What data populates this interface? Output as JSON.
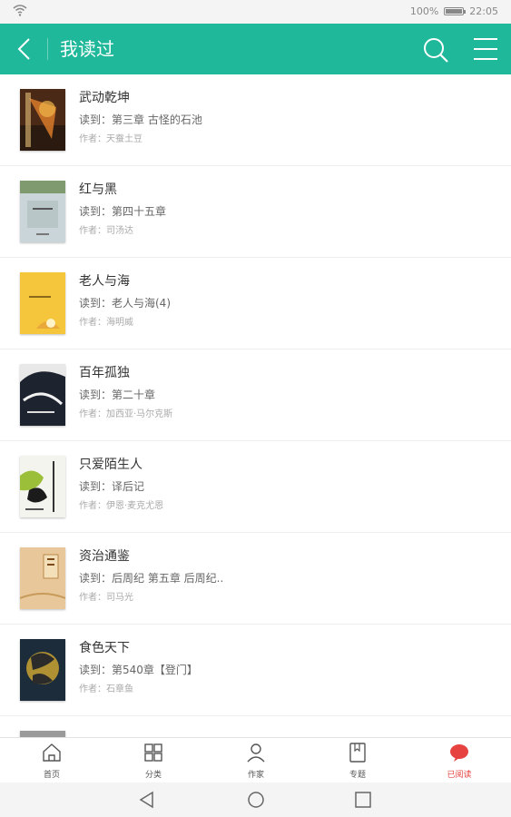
{
  "status": {
    "battery": "100%",
    "time": "22:05",
    "battery_level": 1.0
  },
  "header": {
    "title": "我读过"
  },
  "books": [
    {
      "title": "武动乾坤",
      "read": "读到：第三章 古怪的石池",
      "author": "作者：天蚕土豆"
    },
    {
      "title": "红与黑",
      "read": "读到：第四十五章",
      "author": "作者：司汤达"
    },
    {
      "title": "老人与海",
      "read": "读到：老人与海(4)",
      "author": "作者：海明威"
    },
    {
      "title": "百年孤独",
      "read": "读到：第二十章",
      "author": "作者：加西亚·马尔克斯"
    },
    {
      "title": "只爱陌生人",
      "read": "读到：译后记",
      "author": "作者：伊恩·麦克尤恩"
    },
    {
      "title": "资治通鉴",
      "read": "读到：后周纪 第五章 后周纪..",
      "author": "作者：司马光"
    },
    {
      "title": "食色天下",
      "read": "读到：第540章【登门】",
      "author": "作者：石章鱼"
    },
    {
      "title": "",
      "read": "",
      "author": ""
    }
  ],
  "tabs": [
    {
      "label": "首页",
      "icon": "home-icon"
    },
    {
      "label": "分类",
      "icon": "grid-icon"
    },
    {
      "label": "作家",
      "icon": "person-icon"
    },
    {
      "label": "专题",
      "icon": "bookmark-icon"
    },
    {
      "label": "已阅读",
      "icon": "chat-bubble-icon",
      "active": true
    }
  ],
  "colors": {
    "accent": "#1fb89a",
    "active_tab": "#e64340"
  }
}
